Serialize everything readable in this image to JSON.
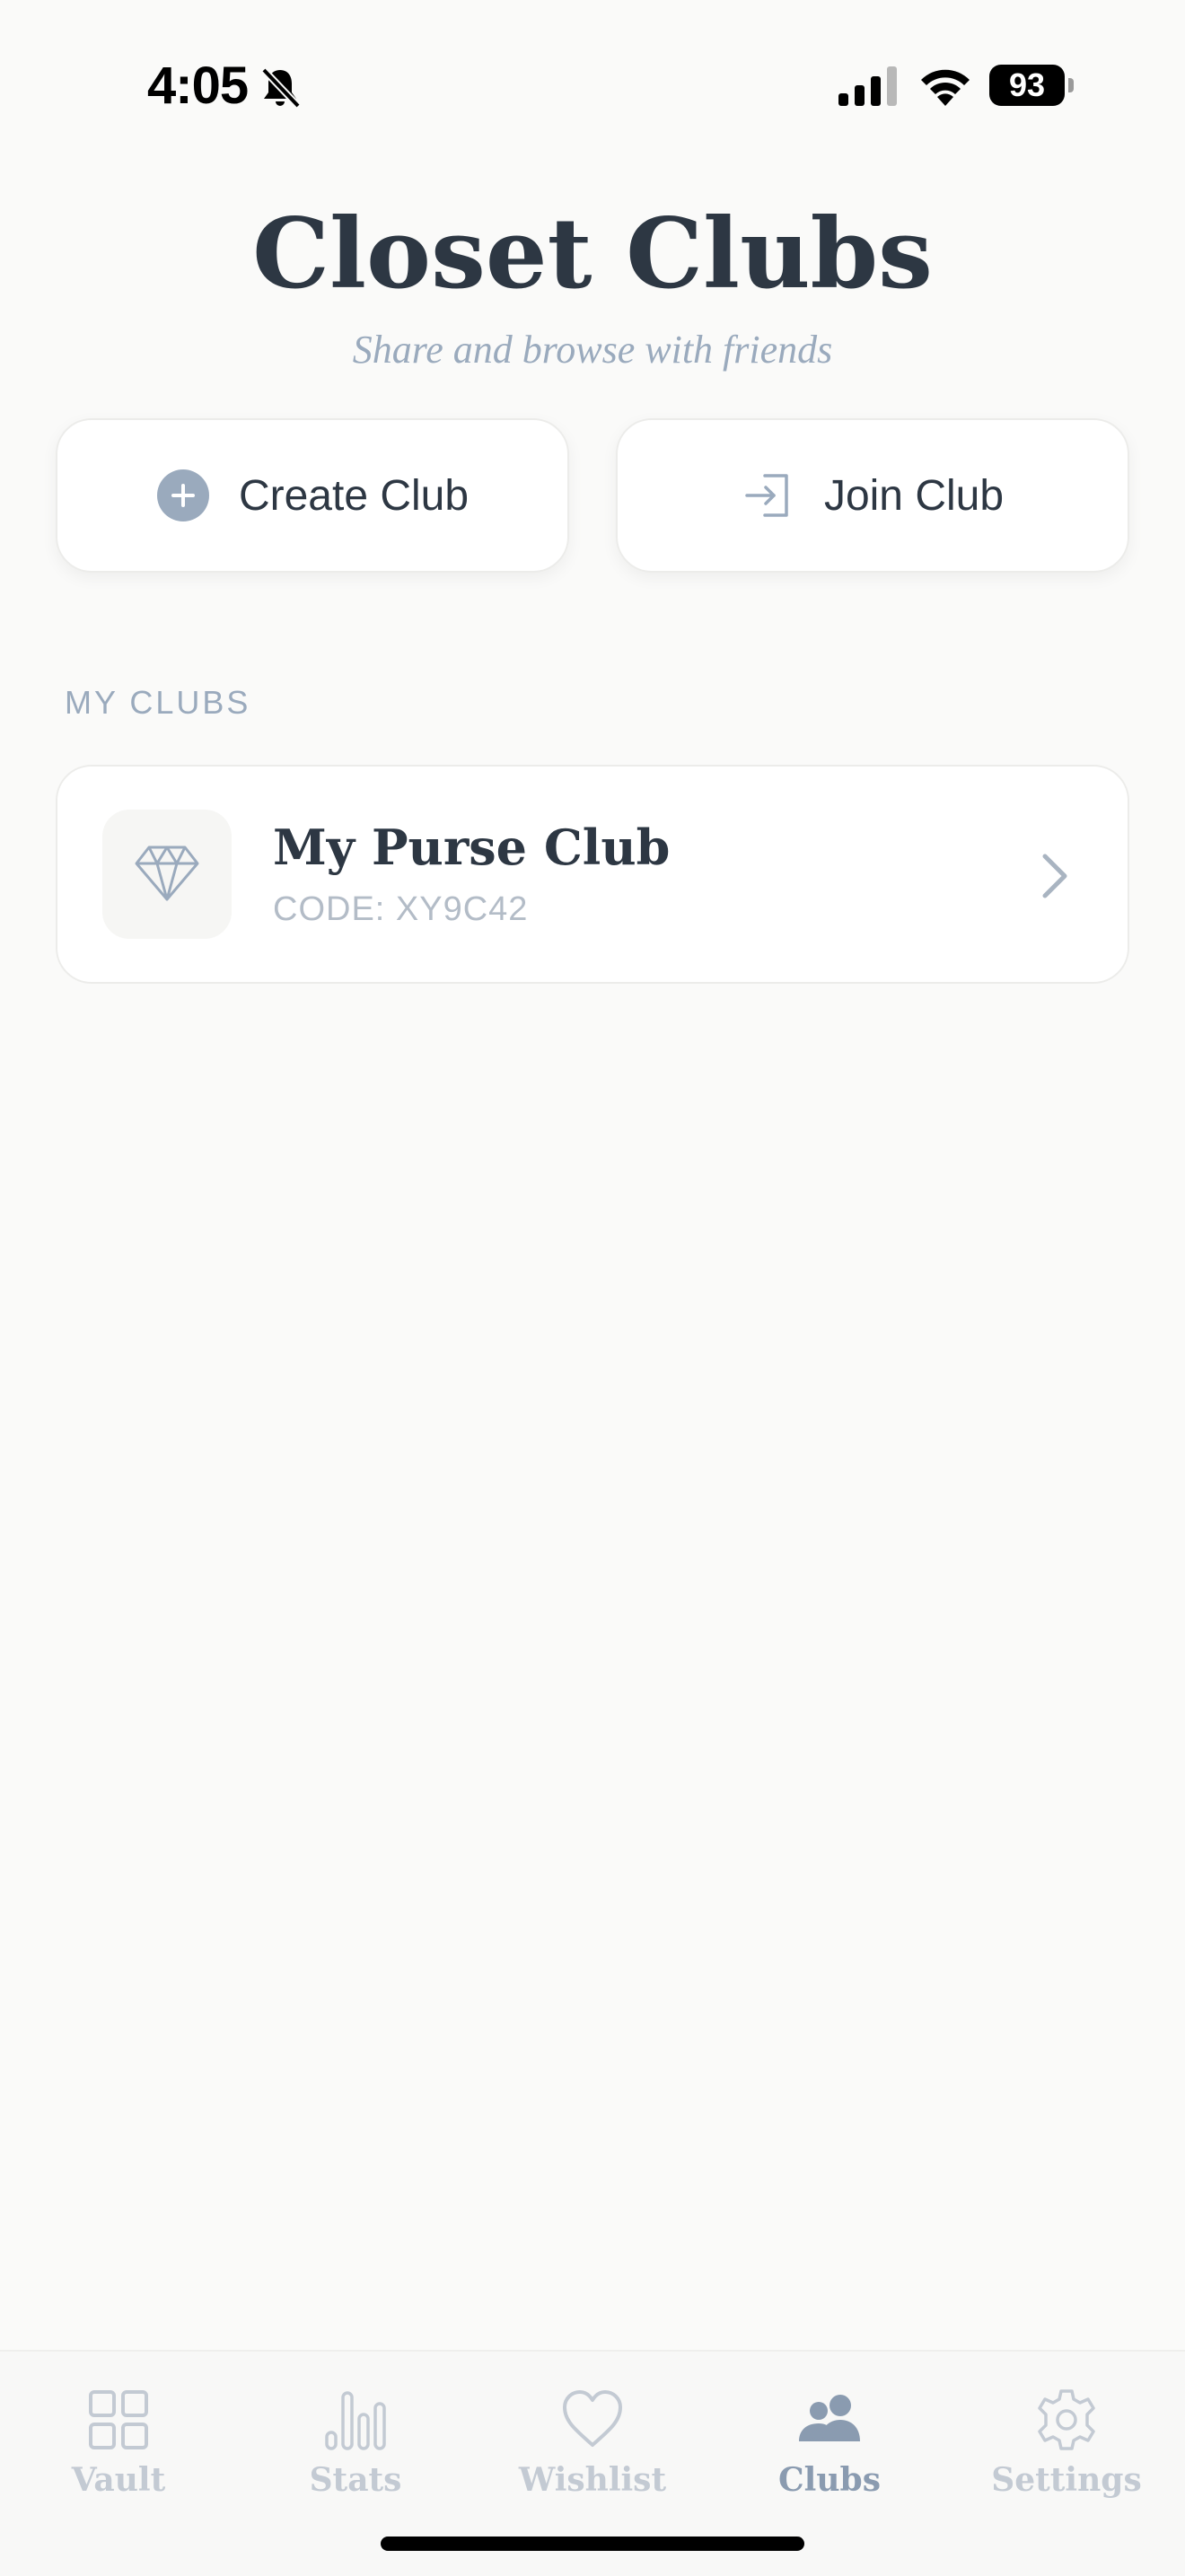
{
  "status_bar": {
    "time": "4:05",
    "battery": "93"
  },
  "header": {
    "title": "Closet Clubs",
    "subtitle": "Share and browse with friends"
  },
  "actions": {
    "create_label": "Create Club",
    "join_label": "Join Club"
  },
  "section": {
    "my_clubs_heading": "MY CLUBS"
  },
  "clubs": [
    {
      "name": "My Purse Club",
      "code": "CODE: XY9C42",
      "icon": "diamond-icon"
    }
  ],
  "tab_bar": {
    "tabs": [
      {
        "label": "Vault",
        "icon": "grid-icon",
        "active": false
      },
      {
        "label": "Stats",
        "icon": "bar-chart-icon",
        "active": false
      },
      {
        "label": "Wishlist",
        "icon": "heart-icon",
        "active": false
      },
      {
        "label": "Clubs",
        "icon": "people-icon",
        "active": true
      },
      {
        "label": "Settings",
        "icon": "gear-icon",
        "active": false
      }
    ]
  },
  "colors": {
    "background": "#fafaf9",
    "title": "#2d3743",
    "muted": "#9aaabd",
    "accent": "#8a9bb0",
    "inactive_tab": "#c3cad3"
  }
}
